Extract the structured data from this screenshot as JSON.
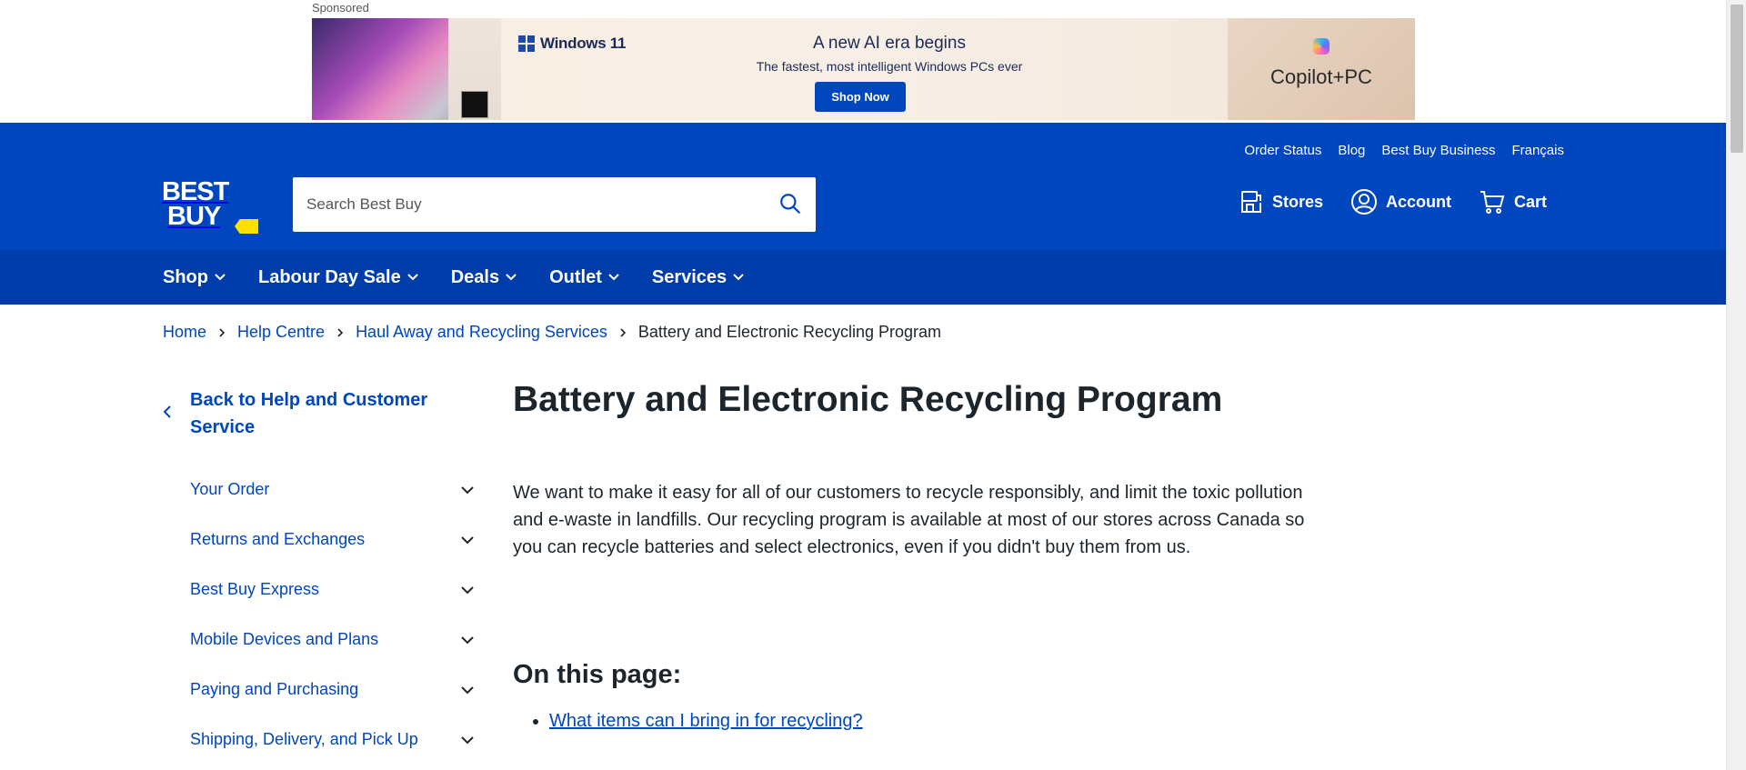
{
  "ad": {
    "sponsored_label": "Sponsored",
    "brand": "Windows 11",
    "headline": "A new AI era begins",
    "subline": "The fastest, most intelligent Windows PCs ever",
    "cta": "Shop Now",
    "copilot": "Copilot+PC"
  },
  "header": {
    "utility_links": [
      "Order Status",
      "Blog",
      "Best Buy Business",
      "Français"
    ],
    "logo": {
      "line1": "BEST",
      "line2": "BUY"
    },
    "search": {
      "placeholder": "Search Best Buy",
      "value": ""
    },
    "actions": {
      "stores": "Stores",
      "account": "Account",
      "cart": "Cart"
    },
    "colors": {
      "primary": "#0046be",
      "nav": "#003daa",
      "logo_tag": "#ffe000"
    }
  },
  "nav": {
    "items": [
      "Shop",
      "Labour Day Sale",
      "Deals",
      "Outlet",
      "Services"
    ]
  },
  "breadcrumb": {
    "items": [
      "Home",
      "Help Centre",
      "Haul Away and Recycling Services"
    ],
    "current": "Battery and Electronic Recycling Program"
  },
  "sidebar": {
    "back_label": "Back to Help and Customer Service",
    "items": [
      "Your Order",
      "Returns and Exchanges",
      "Best Buy Express",
      "Mobile Devices and Plans",
      "Paying and Purchasing",
      "Shipping, Delivery, and Pick Up"
    ]
  },
  "main": {
    "title": "Battery and Electronic Recycling Program",
    "intro": "We want to make it easy for all of our customers to recycle responsibly, and limit the toxic pollution and e-waste in landfills. Our recycling program is available at most of our stores across Canada so you can recycle batteries and select electronics, even if you didn't buy them from us.",
    "on_this_page_title": "On this page:",
    "toc": [
      "What items can I bring in for recycling?"
    ]
  }
}
